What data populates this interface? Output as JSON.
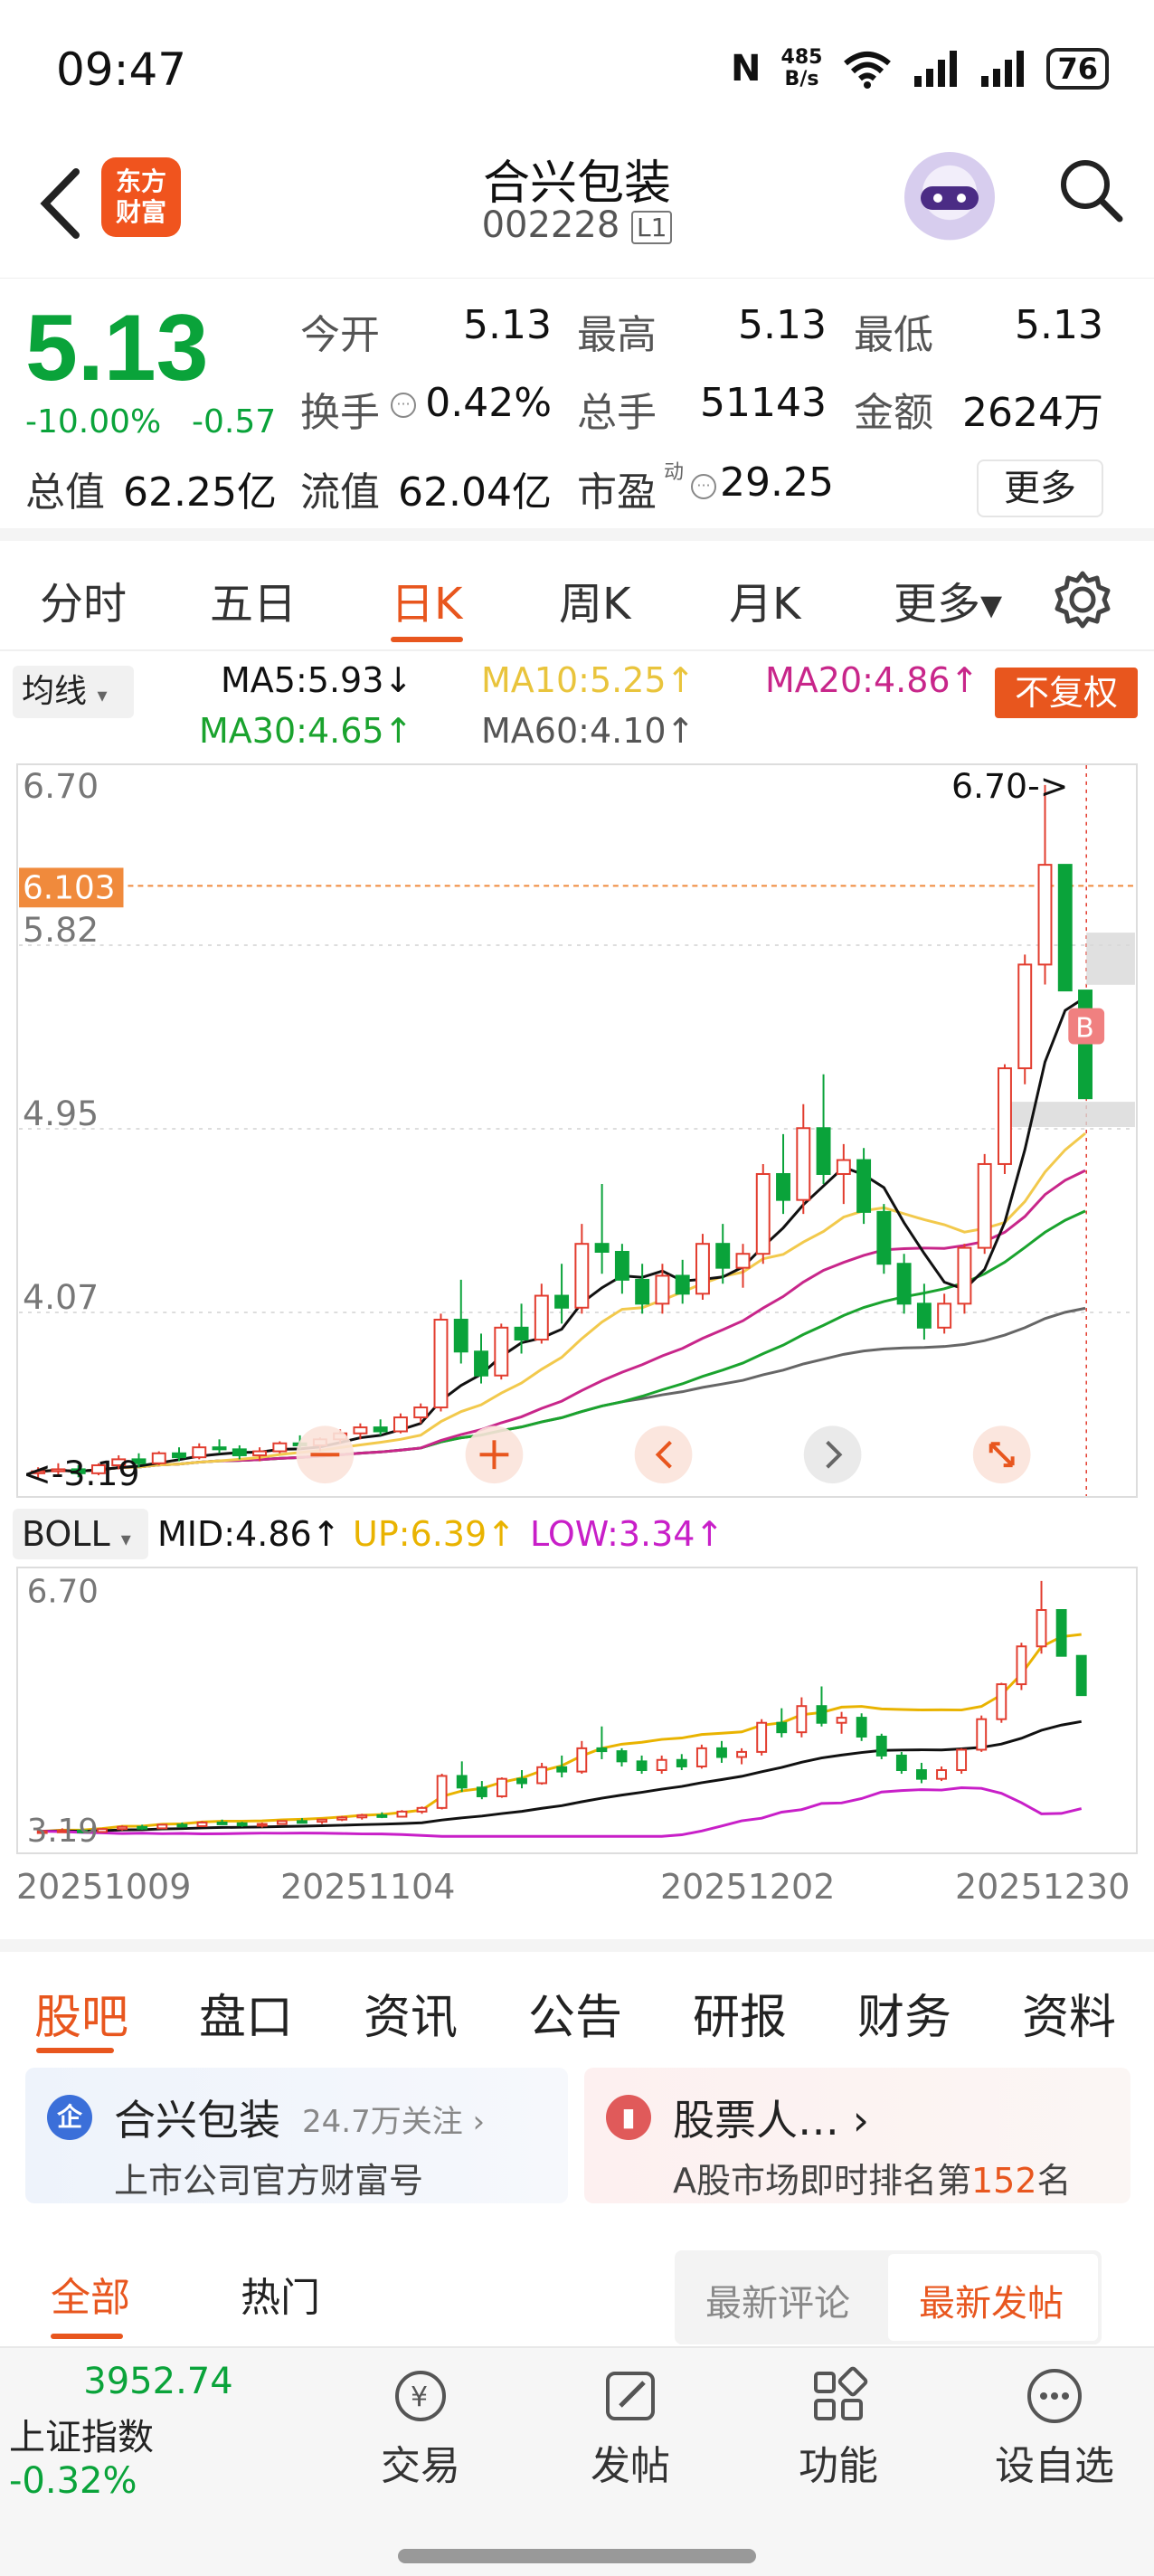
{
  "status_bar": {
    "time": "09:47",
    "net_speed_top": "485",
    "net_speed_bottom": "B/s",
    "battery": "76"
  },
  "header": {
    "logo_line1": "东方",
    "logo_line2": "财富",
    "stock_name": "合兴包装",
    "stock_code": "002228",
    "level": "L1"
  },
  "quote": {
    "price": "5.13",
    "change_pct": "-10.00%",
    "change": "-0.57",
    "open_label": "今开",
    "open": "5.13",
    "high_label": "最高",
    "high": "5.13",
    "low_label": "最低",
    "low": "5.13",
    "turnover_label": "换手",
    "turnover": "0.42%",
    "volume_label": "总手",
    "volume": "51143",
    "amount_label": "金额",
    "amount": "2624万",
    "mcap_label": "总值",
    "mcap": "62.25亿",
    "float_label": "流值",
    "float": "62.04亿",
    "pe_label": "市盈",
    "pe_sup": "动",
    "pe": "29.25",
    "more_label": "更多"
  },
  "period_tabs": [
    "分时",
    "五日",
    "日K",
    "周K",
    "月K",
    "更多▾"
  ],
  "active_period": "日K",
  "ma_legend": {
    "selector": "均线",
    "ma5": "MA5:5.93↓",
    "ma10": "MA10:5.25↑",
    "ma20": "MA20:4.86↑",
    "ma30": "MA30:4.65↑",
    "ma60": "MA60:4.10↑",
    "adjust": "不复权",
    "colors": {
      "ma5": "#111111",
      "ma10": "#f2c94c",
      "ma20": "#c8268a",
      "ma30": "#1aa32e",
      "ma60": "#666666"
    }
  },
  "kline_labels": {
    "y_top": "6.70",
    "crosshair": "6.103",
    "y2": "5.82",
    "y3": "4.95",
    "y4": "4.07",
    "max_marker": "6.70->",
    "min_marker": "<-3.19",
    "buy_marker": "B"
  },
  "boll_legend": {
    "selector": "BOLL",
    "mid": "MID:4.86↑",
    "up": "UP:6.39↑",
    "low": "LOW:3.34↑",
    "y_top": "6.70",
    "y_bottom": "3.19"
  },
  "dates": [
    "20251009",
    "20251104",
    "20251202",
    "20251230"
  ],
  "chart_data": {
    "type": "candlestick",
    "y_range": [
      3.19,
      6.7
    ],
    "candles": [
      [
        3.25,
        3.28,
        3.22,
        3.26
      ],
      [
        3.26,
        3.3,
        3.24,
        3.27
      ],
      [
        3.27,
        3.29,
        3.23,
        3.25
      ],
      [
        3.25,
        3.3,
        3.24,
        3.29
      ],
      [
        3.29,
        3.34,
        3.27,
        3.32
      ],
      [
        3.32,
        3.35,
        3.28,
        3.3
      ],
      [
        3.3,
        3.36,
        3.29,
        3.35
      ],
      [
        3.35,
        3.38,
        3.31,
        3.33
      ],
      [
        3.33,
        3.4,
        3.32,
        3.38
      ],
      [
        3.38,
        3.42,
        3.35,
        3.37
      ],
      [
        3.37,
        3.39,
        3.32,
        3.34
      ],
      [
        3.34,
        3.38,
        3.31,
        3.36
      ],
      [
        3.36,
        3.41,
        3.35,
        3.4
      ],
      [
        3.4,
        3.44,
        3.37,
        3.39
      ],
      [
        3.39,
        3.43,
        3.36,
        3.42
      ],
      [
        3.42,
        3.47,
        3.4,
        3.45
      ],
      [
        3.45,
        3.5,
        3.42,
        3.48
      ],
      [
        3.48,
        3.52,
        3.44,
        3.46
      ],
      [
        3.46,
        3.55,
        3.45,
        3.53
      ],
      [
        3.53,
        3.6,
        3.5,
        3.58
      ],
      [
        3.58,
        4.05,
        3.56,
        4.02
      ],
      [
        4.02,
        4.22,
        3.8,
        3.86
      ],
      [
        3.86,
        3.95,
        3.7,
        3.74
      ],
      [
        3.74,
        4.0,
        3.72,
        3.98
      ],
      [
        3.98,
        4.1,
        3.85,
        3.92
      ],
      [
        3.92,
        4.2,
        3.9,
        4.14
      ],
      [
        4.14,
        4.3,
        4.0,
        4.08
      ],
      [
        4.08,
        4.5,
        4.05,
        4.4
      ],
      [
        4.4,
        4.7,
        4.25,
        4.36
      ],
      [
        4.36,
        4.4,
        4.15,
        4.22
      ],
      [
        4.22,
        4.3,
        4.05,
        4.1
      ],
      [
        4.1,
        4.3,
        4.05,
        4.24
      ],
      [
        4.24,
        4.32,
        4.1,
        4.15
      ],
      [
        4.15,
        4.45,
        4.12,
        4.4
      ],
      [
        4.4,
        4.5,
        4.2,
        4.28
      ],
      [
        4.28,
        4.4,
        4.18,
        4.35
      ],
      [
        4.35,
        4.8,
        4.3,
        4.75
      ],
      [
        4.75,
        4.95,
        4.55,
        4.62
      ],
      [
        4.62,
        5.1,
        4.55,
        4.98
      ],
      [
        4.98,
        5.25,
        4.7,
        4.75
      ],
      [
        4.75,
        4.9,
        4.6,
        4.82
      ],
      [
        4.82,
        4.88,
        4.5,
        4.56
      ],
      [
        4.56,
        4.6,
        4.25,
        4.3
      ],
      [
        4.3,
        4.35,
        4.05,
        4.1
      ],
      [
        4.1,
        4.2,
        3.92,
        3.98
      ],
      [
        3.98,
        4.15,
        3.95,
        4.1
      ],
      [
        4.1,
        4.4,
        4.05,
        4.38
      ],
      [
        4.38,
        4.85,
        4.35,
        4.8
      ],
      [
        4.8,
        5.3,
        4.75,
        5.28
      ],
      [
        5.28,
        5.85,
        5.2,
        5.8
      ],
      [
        5.8,
        6.7,
        5.7,
        6.3
      ],
      [
        6.3,
        6.3,
        5.67,
        5.67
      ],
      [
        5.67,
        5.67,
        5.13,
        5.13
      ]
    ]
  }
}
